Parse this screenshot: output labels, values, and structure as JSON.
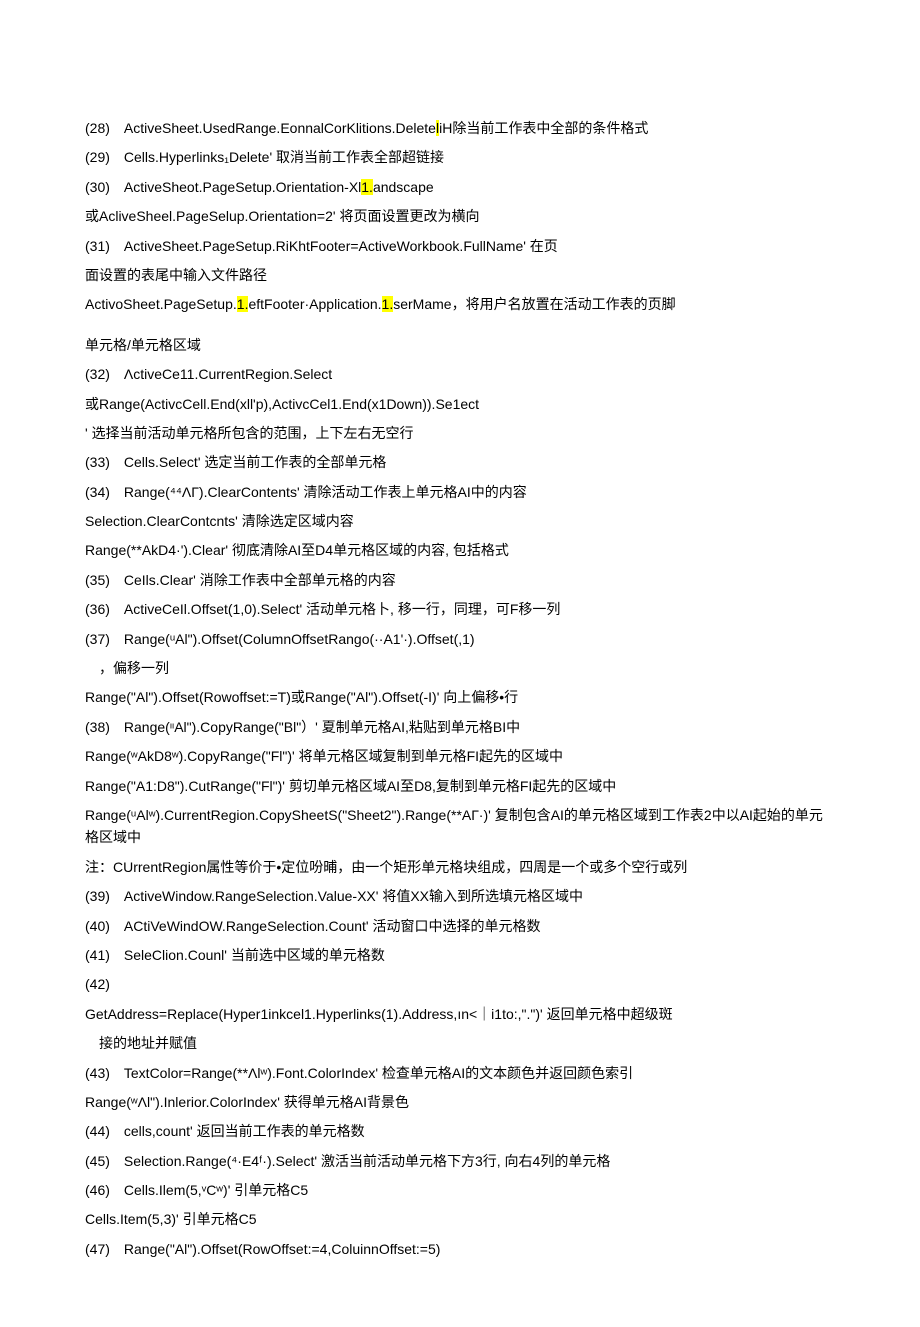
{
  "lines": [
    {
      "pre": "(28) ActiveSheet.UsedRange.EonnalCorKlitions.Delete",
      "hl": "l",
      "post": "iH除当前工作表中全部的条件格式"
    },
    {
      "pre": "(29) Cells.Hyperlinks₁Delete' 取消当前工作表全部超链接"
    },
    {
      "pre": "(30) ActiveSheot.PageSetup.Orientation-Xl",
      "hl": "1.",
      "post": "andscape"
    },
    {
      "pre": "或AcliveSheel.PageSelup.Orientation=2' 将页面设置更改为横向"
    },
    {
      "pre": "(31) ActiveSheet.PageSetup.RiKhtFooter=ActiveWorkbook.FullName' 在页"
    },
    {
      "pre": "面设置的表尾中输入文件路径"
    },
    {
      "pre": "ActivoSheet.PageSetup.",
      "hl": "1.",
      "mid": "eftFooter·Application.",
      "hl2": "1.",
      "post": "serMame，将用户名放置在活动工作表的页脚"
    },
    {
      "pre": "单元格/单元格区域",
      "gap": true
    },
    {
      "pre": "(32) ΛctiveCe11.CurrentRegion.Select"
    },
    {
      "pre": "或Range(ActivcCell.End(xll'p),ActivcCel1.End(x1Down)).Se1ect"
    },
    {
      "pre": "' 选择当前活动单元格所包含的范围，上下左右无空行"
    },
    {
      "pre": "(33) Cells.Select' 选定当前工作表的全部单元格"
    },
    {
      "pre": "(34) Range(⁴⁴ΛΓ).ClearContents' 清除活动工作表上单元格AI中的内容"
    },
    {
      "pre": "Selection.ClearContcnts' 清除选定区域内容"
    },
    {
      "pre": "Range(**AkD4·').Clear' 彻底清除AI至D4单元格区域的内容, 包括格式"
    },
    {
      "pre": "(35) CeIls.Clear' 消除工作表中全部单元格的内容"
    },
    {
      "pre": "(36) ActiveCeIl.Offset(1,0).Select' 活动单元格卜, 移一行，同理，可F移一列"
    },
    {
      "pre": "(37) Range(ᵘAl\").Offset(ColumnOffsetRango(··A1'·).Offset(,1)"
    },
    {
      "pre": "，偏移一列",
      "indent": true
    },
    {
      "pre": "Range(\"Al\").Offset(Rowoffset:=T)或Range(\"Al\").Offset(-I)' 向上偏移•行"
    },
    {
      "pre": "(38) Range(ᶥᶥAl\").CopyRange(\"Bl\"）' 夏制单元格AI,粘贴到单元格BI中"
    },
    {
      "pre": "Range(ʷAkD8ʷ).CopyRange(\"Fl\")' 将单元格区域复制到单元格FI起先的区域中"
    },
    {
      "pre": "Range(\"A1:D8\").CutRange(\"Fl\")' 剪切单元格区域AI至D8,复制到单元格FI起先的区域中"
    },
    {
      "pre": "Range(ᵘAlʷ).CurrentRegion.CopySheetS(\"Sheet2\").Range(**AГ·)' 复制包含AI的单元格区域到工作表2中以AI起始的单元格区域中"
    },
    {
      "pre": "注：CUrrentRegion属性等价于•定位吩晡，由一个矩形单元格块组成，四周是一个或多个空行或列"
    },
    {
      "pre": "(39) ActiveWindow.RangeSelection.Value-XX' 将值XX输入到所选填元格区域中"
    },
    {
      "pre": "(40) ACtiVeWindOW.RangeSelection.Count' 活动窗口中选择的单元格数"
    },
    {
      "pre": "(41) SeleClion.Counl' 当前选中区域的单元格数"
    },
    {
      "pre": "(42)"
    },
    {
      "pre": "GetAddress=Replace(Hyper1inkcel1.Hyperlinks(1).Address,ın<｜i1to:,\".\")' 返回单元格中超级斑"
    },
    {
      "pre": "接的地址并赋值",
      "indent": true
    },
    {
      "pre": "(43) TextColor=Range(**Λlʷ).Font.ColorIndex' 检查单元格AI的文本颜色并返回颜色索引"
    },
    {
      "pre": "Range(ʷΛl\").Inlerior.ColorIndex' 获得单元格AI背景色"
    },
    {
      "pre": "(44) cells,count' 返回当前工作表的单元格数"
    },
    {
      "pre": "(45) Selection.Range(⁴·E4ᶠ·).Select' 激活当前活动单元格下方3行, 向右4列的单元格"
    },
    {
      "pre": "(46) Cells.Ilem(5,ᵛCʷ)' 引单元格C5"
    },
    {
      "pre": "Cells.Item(5,3)' 引单元格C5"
    },
    {
      "pre": "(47) Range(\"Al\").Offset(RowOffset:=4,ColuinnOffset:=5)"
    }
  ]
}
